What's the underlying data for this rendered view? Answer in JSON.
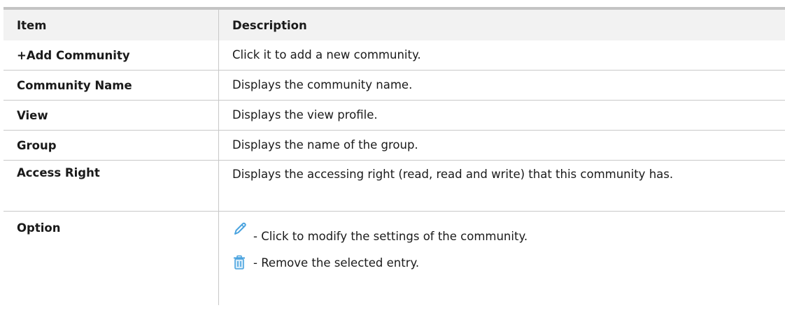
{
  "table": {
    "headers": {
      "item": "Item",
      "description": "Description"
    },
    "rows": [
      {
        "item": "+Add Community",
        "description": "Click it to add a new community."
      },
      {
        "item": "Community Name",
        "description": "Displays the community name."
      },
      {
        "item": "View",
        "description": "Displays the view profile."
      },
      {
        "item": "Group",
        "description": "Displays the name of the group."
      },
      {
        "item": "Access Right",
        "description": "Displays the accessing right (read, read and write) that this community has."
      },
      {
        "item": "Option",
        "options": [
          {
            "icon": "pencil-edit-icon",
            "text": "- Click to modify the settings of the community."
          },
          {
            "icon": "trash-icon",
            "text": "- Remove the selected entry."
          }
        ]
      }
    ]
  },
  "colors": {
    "icon_blue": "#4aa3df",
    "header_bg": "#f2f2f2",
    "top_rule": "#c4c4c4"
  }
}
